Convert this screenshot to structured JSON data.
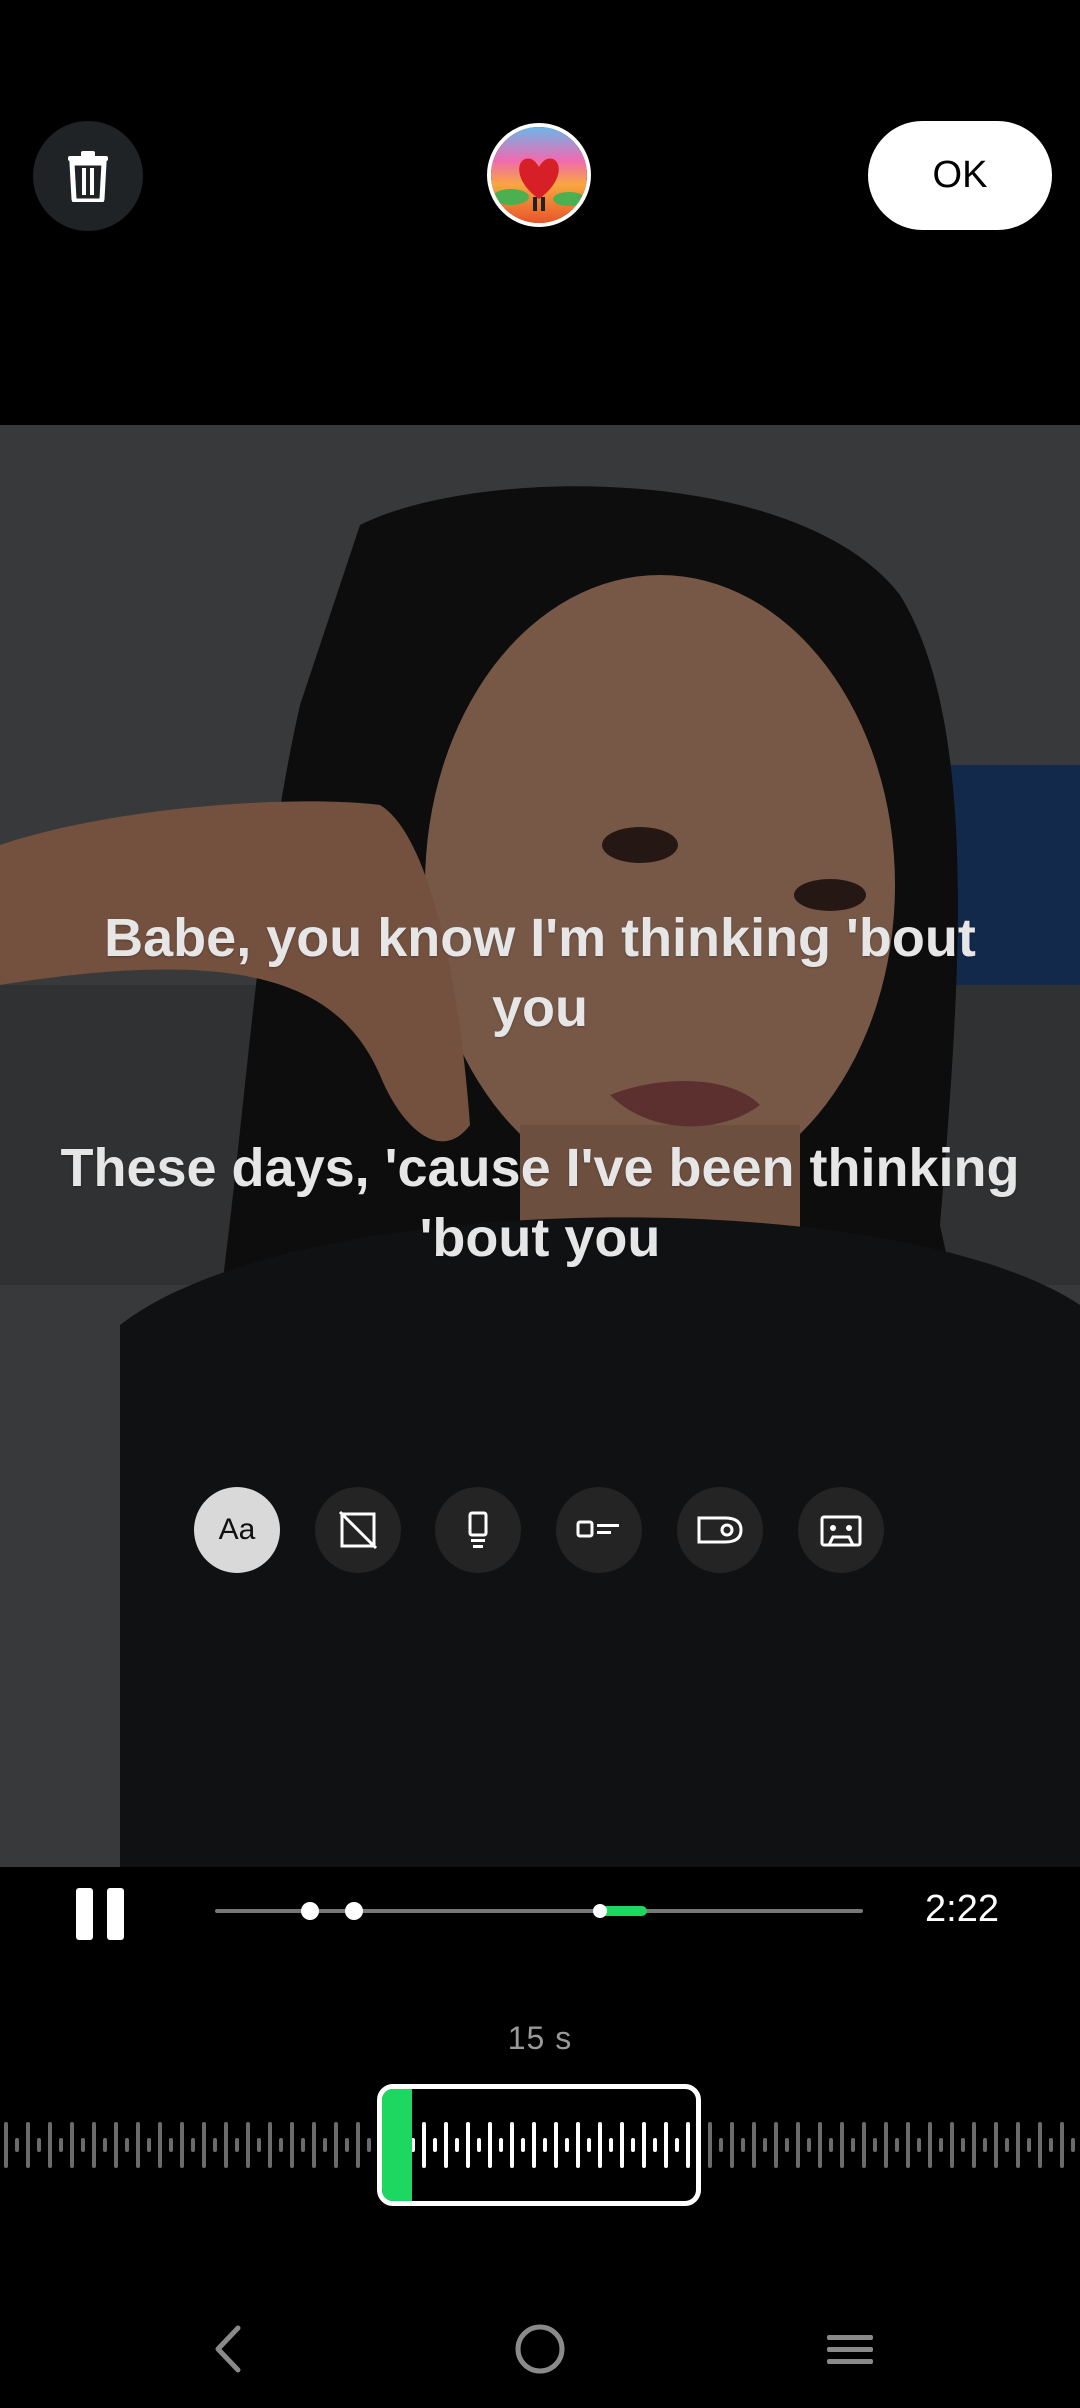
{
  "header": {
    "ok_label": "OK",
    "trash_icon": "trash-icon",
    "sticker": "album-art-sticker"
  },
  "lyrics": {
    "line1": "Babe, you know I'm thinking 'bout you",
    "line2": "These days, 'cause I've been thinking 'bout you"
  },
  "tools": [
    {
      "name": "font-style",
      "label": "Aa",
      "active": true
    },
    {
      "name": "no-background-icon"
    },
    {
      "name": "sticker-style-icon"
    },
    {
      "name": "lyric-card-icon"
    },
    {
      "name": "tag-style-icon"
    },
    {
      "name": "cassette-icon"
    }
  ],
  "player": {
    "state": "playing",
    "time": "2:22",
    "selection_duration": "15 s",
    "position_fraction": 0.61
  },
  "colors": {
    "accent": "#1ed760",
    "background": "#000000",
    "ok_button": "#ffffff"
  },
  "nav": [
    "back-icon",
    "home-icon",
    "recents-icon"
  ]
}
